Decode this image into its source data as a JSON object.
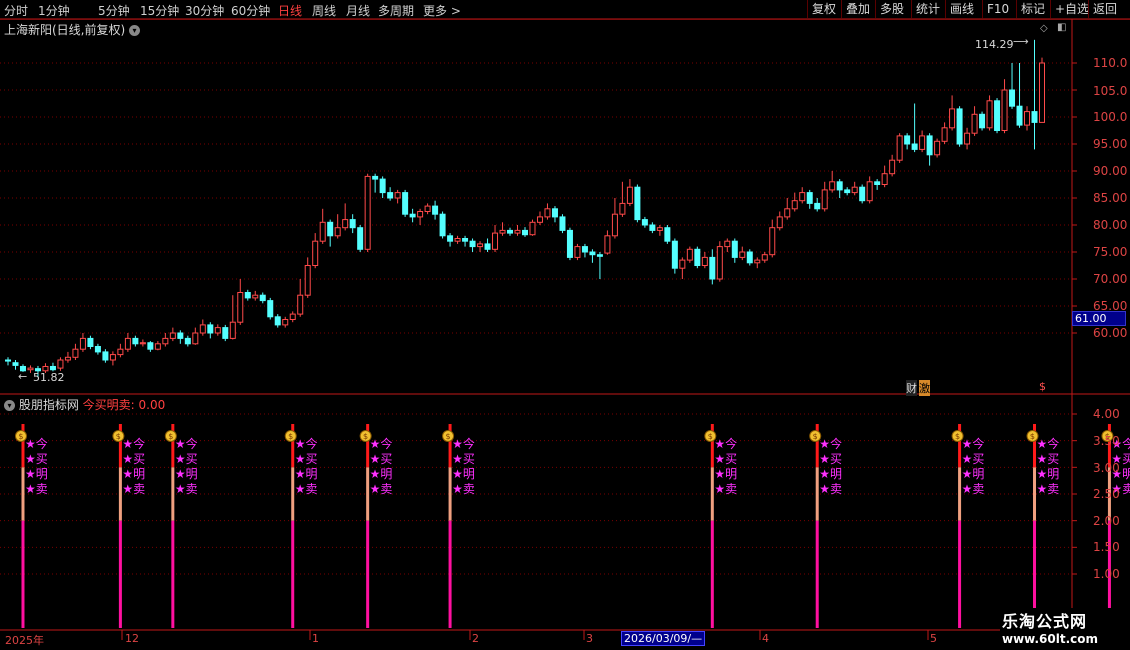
{
  "periods": [
    {
      "label": "分时"
    },
    {
      "label": "1分钟"
    },
    {
      "label": "5分钟"
    },
    {
      "label": "15分钟"
    },
    {
      "label": "30分钟"
    },
    {
      "label": "60分钟"
    },
    {
      "label": "日线",
      "active": true
    },
    {
      "label": "周线"
    },
    {
      "label": "月线"
    },
    {
      "label": "多周期"
    },
    {
      "label": "更多 >"
    }
  ],
  "right_buttons": [
    "复权",
    "叠加",
    "多股",
    "统计",
    "画线",
    "F10",
    "标记",
    "+自选",
    "返回"
  ],
  "stock": {
    "title": "上海新阳(日线,前复权)"
  },
  "price_axis": [
    "110.0",
    "105.0",
    "100.0",
    "95.00",
    "90.00",
    "85.00",
    "80.00",
    "75.00",
    "70.00",
    "65.00",
    "60.00"
  ],
  "current_price": "61.00",
  "annotations": {
    "high": "114.29",
    "low": "51.82"
  },
  "event_tags": {
    "cai": "财",
    "shen": "激",
    "dollar": "$"
  },
  "indicator": {
    "name": "股朋指标网",
    "formula": "今买明卖: 0.00"
  },
  "indicator_axis": [
    "4.00",
    "3.50",
    "3.00",
    "2.50",
    "2.00",
    "1.50",
    "1.00"
  ],
  "signal_chars": [
    "★今",
    "★买",
    "★明",
    "★卖"
  ],
  "x_axis": {
    "year": "2025年",
    "months": [
      "12",
      "1",
      "2",
      "3",
      "4",
      "5"
    ],
    "selected_date": "2026/03/09/—"
  },
  "watermark": {
    "name": "乐淘公式网",
    "url": "www.60lt.com"
  },
  "colors": {
    "up": "#ff4a4a",
    "down": "#54ffff",
    "grid": "#7a0000",
    "axis": "#c01818",
    "magenta": "#ff30ff"
  },
  "chart_data": {
    "type": "candlestick",
    "ylim": [
      51.0,
      115.5
    ],
    "candles": [
      [
        55.0,
        54.8,
        55.5,
        54.0
      ],
      [
        54.5,
        54.0,
        55.0,
        53.2
      ],
      [
        53.8,
        53.0,
        54.2,
        52.8
      ],
      [
        53.2,
        53.5,
        54.0,
        52.6
      ],
      [
        53.4,
        53.0,
        53.9,
        51.8
      ],
      [
        53.0,
        53.8,
        54.4,
        52.6
      ],
      [
        53.8,
        53.2,
        54.5,
        52.9
      ],
      [
        53.5,
        55.0,
        55.5,
        53.0
      ],
      [
        55.0,
        55.5,
        56.5,
        54.5
      ],
      [
        55.5,
        57.0,
        58.0,
        55.0
      ],
      [
        57.0,
        59.0,
        60.0,
        56.5
      ],
      [
        59.0,
        57.5,
        59.5,
        57.0
      ],
      [
        57.5,
        56.5,
        58.0,
        56.0
      ],
      [
        56.5,
        55.0,
        57.0,
        54.5
      ],
      [
        55.0,
        56.0,
        56.6,
        54.0
      ],
      [
        56.0,
        57.0,
        58.0,
        55.5
      ],
      [
        57.0,
        59.0,
        60.0,
        56.5
      ],
      [
        59.0,
        58.0,
        59.5,
        57.5
      ],
      [
        58.0,
        58.2,
        58.8,
        57.5
      ],
      [
        58.2,
        57.0,
        58.5,
        56.5
      ],
      [
        57.0,
        58.0,
        58.5,
        56.8
      ],
      [
        58.0,
        59.0,
        60.0,
        57.5
      ],
      [
        59.0,
        60.0,
        61.0,
        58.5
      ],
      [
        60.0,
        59.0,
        60.5,
        58.0
      ],
      [
        59.0,
        58.0,
        59.5,
        57.5
      ],
      [
        58.0,
        60.0,
        61.0,
        57.8
      ],
      [
        60.0,
        61.5,
        62.5,
        59.5
      ],
      [
        61.5,
        60.0,
        62.0,
        59.0
      ],
      [
        60.0,
        61.0,
        61.6,
        59.5
      ],
      [
        61.0,
        59.0,
        61.5,
        58.5
      ],
      [
        59.0,
        62.0,
        67.0,
        58.8
      ],
      [
        62.0,
        67.5,
        70.0,
        61.5
      ],
      [
        67.5,
        66.5,
        68.0,
        66.0
      ],
      [
        66.5,
        67.0,
        67.8,
        66.0
      ],
      [
        67.0,
        66.0,
        67.5,
        65.5
      ],
      [
        66.0,
        63.0,
        66.5,
        62.5
      ],
      [
        63.0,
        61.5,
        63.5,
        61.0
      ],
      [
        61.5,
        62.5,
        63.0,
        61.0
      ],
      [
        62.5,
        63.5,
        64.0,
        62.0
      ],
      [
        63.5,
        67.0,
        70.0,
        63.0
      ],
      [
        67.0,
        72.5,
        74.0,
        66.5
      ],
      [
        72.5,
        77.0,
        78.5,
        72.0
      ],
      [
        77.0,
        80.5,
        83.0,
        76.5
      ],
      [
        80.5,
        78.0,
        81.0,
        76.0
      ],
      [
        78.0,
        79.5,
        82.0,
        77.5
      ],
      [
        79.5,
        81.0,
        84.0,
        79.0
      ],
      [
        81.0,
        79.5,
        82.0,
        78.5
      ],
      [
        79.5,
        75.5,
        80.0,
        75.0
      ],
      [
        75.5,
        89.0,
        89.5,
        75.0
      ],
      [
        89.0,
        88.5,
        89.5,
        86.0
      ],
      [
        88.5,
        86.0,
        89.0,
        85.0
      ],
      [
        86.0,
        85.0,
        87.0,
        84.5
      ],
      [
        85.0,
        86.0,
        86.5,
        84.0
      ],
      [
        86.0,
        82.0,
        86.5,
        81.5
      ],
      [
        82.0,
        81.5,
        83.0,
        80.5
      ],
      [
        81.5,
        82.5,
        83.0,
        80.0
      ],
      [
        82.5,
        83.5,
        84.0,
        82.0
      ],
      [
        83.5,
        82.0,
        84.5,
        81.0
      ],
      [
        82.0,
        78.0,
        82.5,
        77.5
      ],
      [
        78.0,
        77.0,
        78.5,
        76.0
      ],
      [
        77.0,
        77.5,
        78.0,
        76.5
      ],
      [
        77.5,
        77.0,
        78.0,
        76.0
      ],
      [
        77.0,
        76.0,
        77.5,
        75.0
      ],
      [
        76.0,
        76.5,
        77.0,
        75.0
      ],
      [
        76.5,
        75.5,
        77.5,
        75.0
      ],
      [
        75.5,
        78.5,
        80.0,
        75.0
      ],
      [
        78.5,
        79.0,
        80.5,
        78.0
      ],
      [
        79.0,
        78.5,
        79.5,
        78.0
      ],
      [
        78.5,
        79.0,
        80.0,
        78.0
      ],
      [
        79.0,
        78.2,
        79.6,
        77.8
      ],
      [
        78.2,
        80.5,
        81.0,
        78.0
      ],
      [
        80.5,
        81.5,
        82.5,
        80.0
      ],
      [
        81.5,
        83.0,
        84.0,
        81.0
      ],
      [
        83.0,
        81.5,
        83.5,
        80.5
      ],
      [
        81.5,
        79.0,
        82.0,
        78.5
      ],
      [
        79.0,
        74.0,
        79.5,
        73.5
      ],
      [
        74.0,
        76.0,
        76.5,
        73.5
      ],
      [
        76.0,
        75.0,
        76.5,
        74.0
      ],
      [
        75.0,
        74.5,
        75.5,
        73.0
      ],
      [
        74.5,
        74.2,
        75.0,
        70.0
      ],
      [
        74.8,
        78.0,
        79.0,
        74.5
      ],
      [
        78.0,
        82.0,
        85.0,
        77.5
      ],
      [
        82.0,
        84.0,
        88.0,
        81.5
      ],
      [
        84.0,
        87.0,
        88.5,
        83.5
      ],
      [
        87.0,
        81.0,
        87.5,
        80.5
      ],
      [
        81.0,
        80.0,
        81.5,
        79.5
      ],
      [
        80.0,
        79.0,
        80.5,
        78.5
      ],
      [
        79.0,
        79.5,
        80.0,
        78.0
      ],
      [
        79.5,
        77.0,
        80.0,
        76.5
      ],
      [
        77.0,
        72.0,
        77.5,
        71.0
      ],
      [
        72.0,
        73.5,
        74.0,
        70.0
      ],
      [
        73.5,
        75.5,
        76.0,
        73.0
      ],
      [
        75.5,
        72.5,
        76.0,
        72.0
      ],
      [
        72.5,
        74.0,
        75.0,
        72.0
      ],
      [
        74.0,
        70.0,
        75.5,
        69.0
      ],
      [
        70.0,
        76.0,
        77.0,
        69.5
      ],
      [
        76.0,
        77.0,
        77.5,
        75.0
      ],
      [
        77.0,
        74.0,
        77.5,
        73.0
      ],
      [
        74.0,
        75.0,
        76.0,
        73.5
      ],
      [
        75.0,
        73.0,
        75.5,
        72.5
      ],
      [
        73.0,
        73.5,
        74.0,
        72.0
      ],
      [
        73.5,
        74.5,
        75.0,
        73.0
      ],
      [
        74.5,
        79.5,
        81.0,
        74.0
      ],
      [
        79.5,
        81.5,
        82.5,
        79.0
      ],
      [
        81.5,
        83.0,
        85.0,
        81.0
      ],
      [
        83.0,
        84.5,
        86.0,
        82.5
      ],
      [
        84.5,
        86.0,
        87.0,
        84.0
      ],
      [
        86.0,
        84.0,
        86.5,
        83.0
      ],
      [
        84.0,
        83.0,
        85.0,
        82.5
      ],
      [
        83.0,
        86.5,
        88.0,
        82.5
      ],
      [
        86.5,
        88.0,
        90.0,
        86.0
      ],
      [
        88.0,
        86.5,
        88.5,
        85.0
      ],
      [
        86.5,
        86.0,
        87.0,
        85.5
      ],
      [
        86.0,
        87.0,
        88.0,
        85.5
      ],
      [
        87.0,
        84.5,
        87.5,
        84.0
      ],
      [
        84.5,
        88.0,
        89.0,
        84.0
      ],
      [
        88.0,
        87.5,
        88.5,
        86.5
      ],
      [
        87.5,
        89.5,
        91.0,
        87.0
      ],
      [
        89.5,
        92.0,
        93.0,
        89.0
      ],
      [
        92.0,
        96.5,
        97.0,
        91.5
      ],
      [
        96.5,
        95.0,
        97.0,
        94.0
      ],
      [
        95.0,
        94.0,
        102.5,
        93.5
      ],
      [
        94.0,
        96.5,
        97.5,
        93.5
      ],
      [
        96.5,
        93.0,
        97.0,
        91.0
      ],
      [
        93.0,
        95.5,
        96.0,
        92.5
      ],
      [
        95.5,
        98.0,
        99.0,
        95.0
      ],
      [
        98.0,
        101.5,
        104.0,
        97.5
      ],
      [
        101.5,
        95.0,
        102.0,
        94.5
      ],
      [
        95.0,
        97.0,
        98.0,
        94.0
      ],
      [
        97.0,
        100.5,
        102.0,
        96.5
      ],
      [
        100.5,
        98.0,
        101.0,
        97.5
      ],
      [
        98.0,
        103.0,
        104.0,
        97.5
      ],
      [
        103.0,
        97.5,
        103.5,
        97.0
      ],
      [
        97.5,
        105.0,
        107.0,
        97.0
      ],
      [
        105.0,
        102.0,
        110.0,
        101.5
      ],
      [
        102.0,
        98.5,
        110.0,
        98.0
      ],
      [
        98.5,
        101.0,
        102.0,
        97.5
      ],
      [
        101.0,
        99.0,
        114.29,
        94.0
      ],
      [
        99.0,
        110.0,
        111.0,
        102.5
      ]
    ],
    "signal_indices": [
      2,
      15,
      22,
      38,
      48,
      59,
      94,
      108,
      127,
      137,
      147,
      155,
      165,
      177
    ],
    "indicator_value": 3.7
  }
}
